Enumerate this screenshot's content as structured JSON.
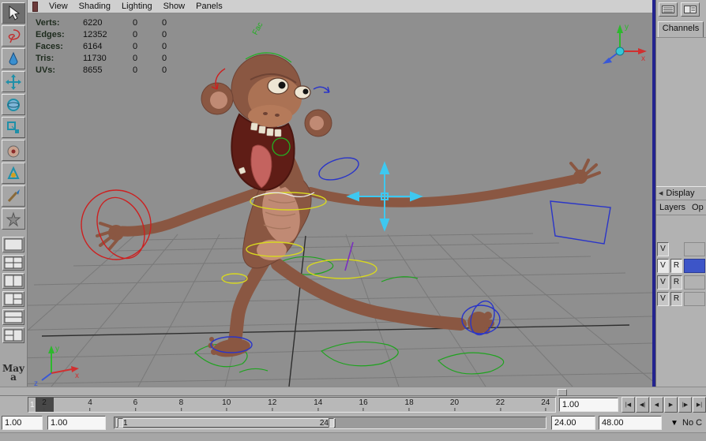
{
  "menubar": {
    "items": [
      {
        "label": "View"
      },
      {
        "label": "Shading"
      },
      {
        "label": "Lighting"
      },
      {
        "label": "Show"
      },
      {
        "label": "Panels"
      }
    ]
  },
  "hud": {
    "rows": [
      {
        "label": "Verts:",
        "total": "6220",
        "selected": "0",
        "other": "0"
      },
      {
        "label": "Edges:",
        "total": "12352",
        "selected": "0",
        "other": "0"
      },
      {
        "label": "Faces:",
        "total": "6164",
        "selected": "0",
        "other": "0"
      },
      {
        "label": "Tris:",
        "total": "11730",
        "selected": "0",
        "other": "0"
      },
      {
        "label": "UVs:",
        "total": "8655",
        "selected": "0",
        "other": "0"
      }
    ]
  },
  "viewport": {
    "selected_curve_label": "Fac",
    "axis_gizmo": {
      "x": "x",
      "y": "y",
      "z": "z"
    },
    "origin_axis": {
      "x": "x",
      "y": "y",
      "z": "z"
    }
  },
  "toolbox": {
    "logo_text": "Maya",
    "tools": [
      "select",
      "lasso",
      "paint-select",
      "move",
      "rotate",
      "scale",
      "soft-mod",
      "manipulator",
      "paint-weights",
      "last-tool"
    ]
  },
  "channel_box": {
    "tab": "Channels",
    "display_tab": "Display",
    "layers_menu": "Layers",
    "options_menu": "Op",
    "layers": [
      {
        "visible": "V",
        "type": "",
        "selected": false
      },
      {
        "visible": "V",
        "type": "R",
        "selected": true
      },
      {
        "visible": "V",
        "type": "R",
        "selected": false
      },
      {
        "visible": "V",
        "type": "R",
        "selected": false
      }
    ]
  },
  "timeline": {
    "current_frame": "1",
    "ticks": [
      "2",
      "4",
      "6",
      "8",
      "10",
      "12",
      "14",
      "16",
      "18",
      "20",
      "22",
      "24"
    ],
    "current_time_field": "1.00",
    "transport": [
      "|◀",
      "◀|",
      "◀",
      "▶",
      "|▶",
      "▶|"
    ]
  },
  "range_slider": {
    "animation_start": "1.00",
    "playback_start": "1.00",
    "bar_start": "1",
    "bar_end": "24",
    "playback_end": "24.00",
    "animation_end": "48.00",
    "character_set": "No C"
  },
  "icons": {
    "tab_prev": "◀",
    "charset_dropdown": "▼"
  }
}
